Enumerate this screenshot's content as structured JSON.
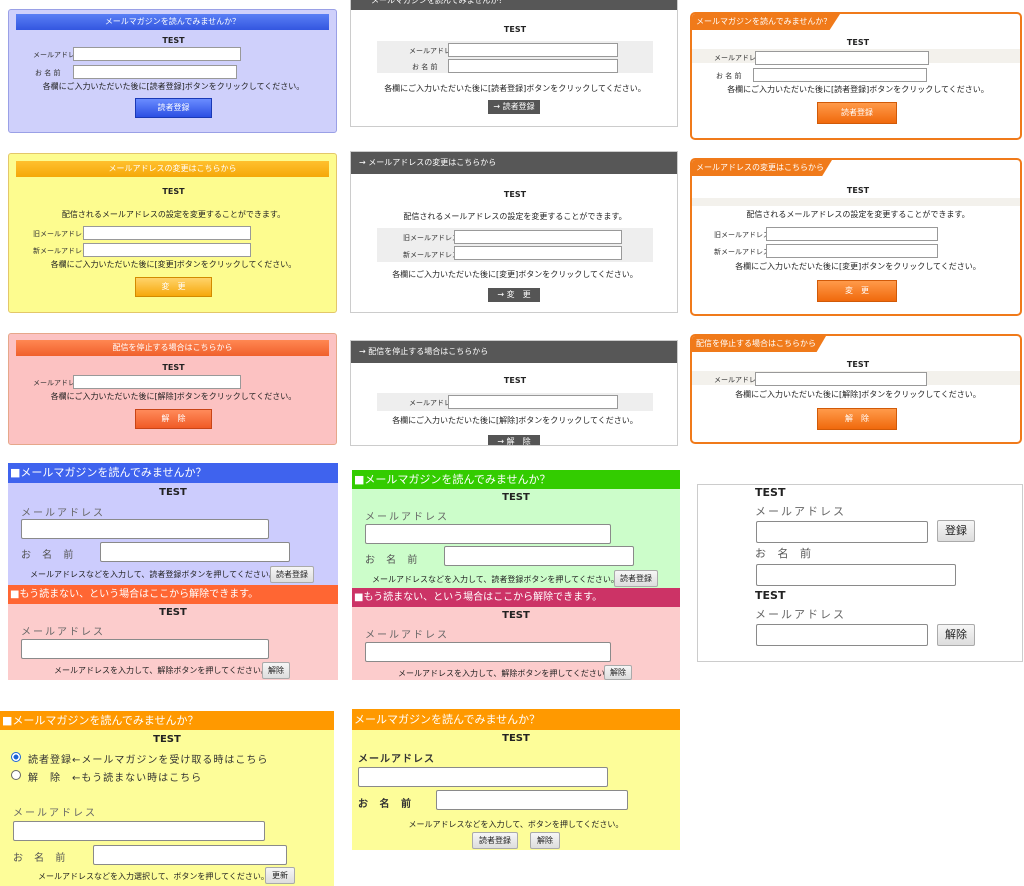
{
  "test": "TEST",
  "subscribe_title": "メールマガジンを読んでみませんか？",
  "subscribe_title_sq": "■メールマガジンを読んでみませんか？",
  "change_title": "メールアドレスの変更はこちらから",
  "change_title_arrow": "→ メールアドレスの変更はこちらから",
  "cancel_title": "配信を停止する場合はこちらから",
  "cancel_title_arrow": "→ 配信を停止する場合はこちらから",
  "unsub_title_sq": "■もう読まない、という場合はここから解除できます。",
  "mail_label": "メールアドレス",
  "mail_label_spaced": "メールアドレス",
  "name_label": "お 名 前",
  "old_mail_label": "旧メールアドレス",
  "new_mail_label": "新メールアドレス",
  "subscribe_note": "各欄にご入力いただいた後に[読者登録]ボタンをクリックしてください。",
  "change_desc": "配信されるメールアドレスの設定を変更することができます。",
  "change_note": "各欄にご入力いただいた後に[変更]ボタンをクリックしてください。",
  "cancel_note": "各欄にご入力いただいた後に[解除]ボタンをクリックしてください。",
  "subscribe_btn": "読者登録",
  "subscribe_btn_arrow": "→ 読者登録",
  "change_btn": "変　更",
  "change_btn_arrow": "→ 変　更",
  "cancel_btn": "解　除",
  "cancel_btn_arrow": "→ 解　除",
  "simple_note_sub": "メールアドレスなどを入力して、読者登録ボタンを押してください。",
  "simple_note_unsub": "メールアドレスを入力して、解除ボタンを押してください。",
  "simple_btn_sub": "読者登録",
  "simple_btn_unsub": "解除",
  "plain_btn_sub": "登録",
  "plain_btn_unsub": "解除",
  "radio_sub": "読者登録←メールマガジンを受け取る時はこちら",
  "radio_unsub": "解　除　←もう読まない時はこちら",
  "radio_note": "メールアドレスなどを入力選択して、ボタンを押してください。",
  "update_btn": "更新",
  "combo_note": "メールアドレスなどを入力して、ボタンを押してください。",
  "colors": {
    "blue_bg": "#cfd0fb",
    "blue_bar": "#3f63ee",
    "yellow_bg": "#fdfc8f",
    "yellow_bar": "#f5a808",
    "pink_bg": "#fcc2c2",
    "pink_bar": "#f36a36",
    "orange": "#f07a1a",
    "gray_bar": "#575757",
    "green_bg": "#ccfdca",
    "green_bar": "#33cc00",
    "magenta_bar": "#cc3366",
    "plain_yellow": "#fdfd99",
    "plain_orange_bar": "#ff9900"
  }
}
